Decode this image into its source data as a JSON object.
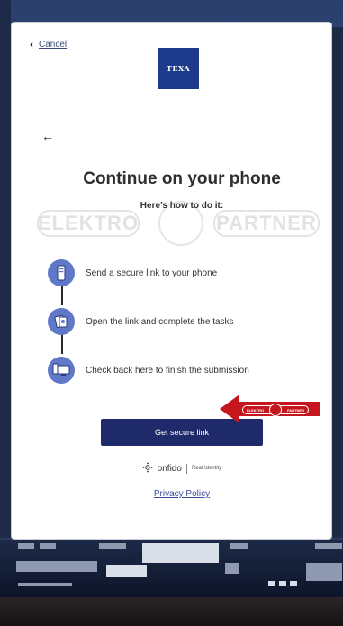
{
  "header": {
    "cancel_label": "Cancel",
    "logo_text": "TEXA"
  },
  "main": {
    "title": "Continue on your phone",
    "subtitle": "Here’s how to do it:",
    "steps": [
      {
        "label": "Send a secure link to your phone",
        "icon": "phone-link-icon"
      },
      {
        "label": "Open the link and complete the tasks",
        "icon": "document-tasks-icon"
      },
      {
        "label": "Check back here to finish the submission",
        "icon": "desktop-phone-icon"
      }
    ],
    "primary_button": "Get secure link"
  },
  "footer": {
    "brand_name": "onfido",
    "brand_tagline": "Real Identity",
    "privacy_link": "Privacy Policy"
  },
  "watermark": {
    "left": "ELEKTRO",
    "right": "PARTNER"
  },
  "overlay_badge": {
    "left": "ELEKTRO",
    "right": "PARTNER"
  },
  "colors": {
    "primary": "#1f2a6b",
    "step_icon": "#5f78c8",
    "logo_bg": "#1e3a8a",
    "link": "#3b4b9a",
    "red_arrow": "#c5161d"
  }
}
